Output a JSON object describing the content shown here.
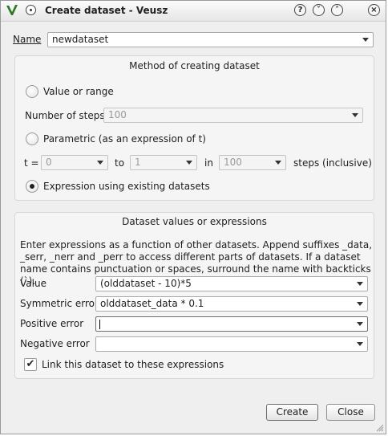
{
  "window": {
    "title": "Create dataset - Veusz",
    "buttons": {
      "help": "?",
      "minimize": "˅",
      "maximize": "˄",
      "close": "×"
    }
  },
  "name": {
    "label": "Name",
    "value": "newdataset"
  },
  "method": {
    "title": "Method of creating dataset",
    "value_or_range": {
      "label": "Value or range",
      "checked": false
    },
    "steps_label": "Number of steps",
    "steps_value": "100",
    "parametric": {
      "label": "Parametric (as an expression of t)",
      "checked": false
    },
    "t_label": "t =",
    "t_from": "0",
    "to_label": "to",
    "t_to": "1",
    "in_label": "in",
    "t_steps": "100",
    "steps_inclusive_label": "steps (inclusive)",
    "expression": {
      "label": "Expression using existing datasets",
      "checked": true
    }
  },
  "values": {
    "title": "Dataset values or expressions",
    "description": "Enter expressions as a function of other datasets. Append suffixes _data, _serr, _nerr and _perr to access different parts of datasets. If a dataset name contains punctuation or spaces, surround the name with backticks (`).",
    "value_label": "Value",
    "value": "(olddataset - 10)*5",
    "sym_label": "Symmetric error",
    "sym_value": "olddataset_data * 0.1",
    "pos_label": "Positive error",
    "pos_value": "",
    "neg_label": "Negative error",
    "neg_value": "",
    "link_label": "Link this dataset to these expressions",
    "link_checked": true
  },
  "footer": {
    "create_label": "Create",
    "close_label": "Close"
  },
  "colors": {
    "accent": "#3a7a1e",
    "group_bg": "#f5f5f5",
    "window_bg": "#efefef"
  }
}
